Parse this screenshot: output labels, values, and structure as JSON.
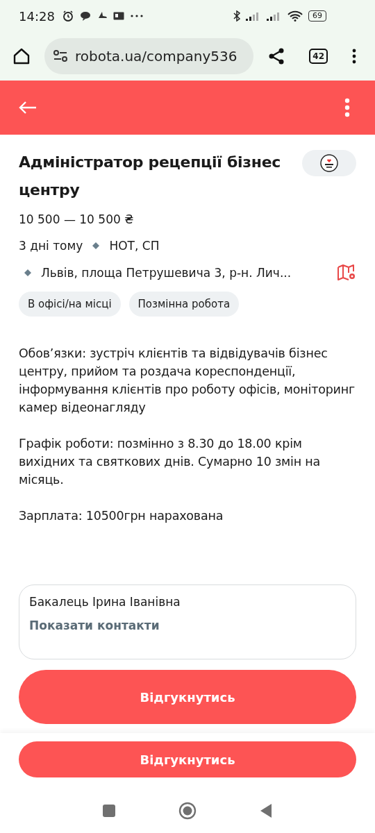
{
  "status_bar": {
    "time": "14:28",
    "battery": "69"
  },
  "browser": {
    "url": "robota.ua/company536",
    "tab_count": "42"
  },
  "vacancy": {
    "title": "Адміністратор рецепції бізнес центру",
    "salary": "10 500 — 10 500 ₴",
    "posted": "3 дні тому",
    "company": "НОТ, СП",
    "location": "Львів, площа Петрушевича 3, р-н. Лич...",
    "tags": [
      "В офісі/на місці",
      "Позмінна робота"
    ],
    "description": [
      "Обов’язки: зустріч клієнтів та відвідувачів бізнес центру, прийом та роздача кореспонденції, інформування клієнтів про роботу офісів, моніторинг камер відеонагляду",
      "Графік роботи: позмінно з 8.30 до 18.00  крім вихідних та святкових днів. Сумарно 10 змін на місяць.",
      "Зарплата: 10500грн нарахована"
    ]
  },
  "contact": {
    "name": "Бакалець Ірина Іванівна",
    "link": "Показати контакти"
  },
  "apply_button": "Відгукнутись",
  "sticky_apply_button": "Відгукнутись"
}
